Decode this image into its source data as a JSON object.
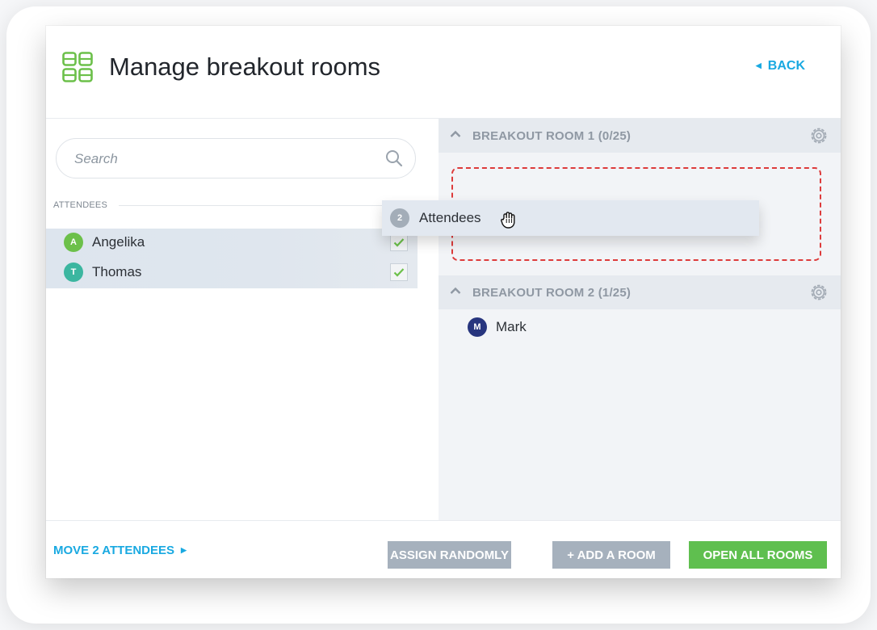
{
  "dialog": {
    "title": "Manage breakout rooms",
    "back_label": "BACK"
  },
  "search": {
    "placeholder": "Search"
  },
  "attendees": {
    "section_label": "ATTENDEES",
    "items": [
      {
        "name": "Angelika",
        "initial": "A",
        "color": "#6cc04a",
        "checked": true
      },
      {
        "name": "Thomas",
        "initial": "T",
        "color": "#3bb6a0",
        "checked": true
      }
    ]
  },
  "rooms": [
    {
      "title": "BREAKOUT ROOM 1 (0/25)",
      "members": []
    },
    {
      "title": "BREAKOUT ROOM 2 (1/25)",
      "members": [
        {
          "name": "Mark",
          "initial": "M",
          "color": "#27357e"
        }
      ]
    }
  ],
  "drag_chip": {
    "count": "2",
    "label": "Attendees"
  },
  "footer": {
    "move_label": "MOVE 2 ATTENDEES",
    "assign_label": "ASSIGN RANDOMLY",
    "add_room_label": "+ ADD A ROOM",
    "open_all_label": "OPEN ALL ROOMS"
  },
  "colors": {
    "accent": "#19a9e1",
    "primary_button": "#5fbf4f",
    "secondary_button": "#a6b1bd",
    "dropzone_border": "#dd3b3b"
  }
}
